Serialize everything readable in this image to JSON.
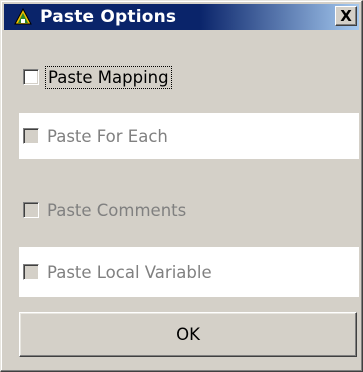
{
  "dialog": {
    "title": "Paste Options",
    "title_icon": "paste-app-icon",
    "close_label": "X",
    "close_icon": "close-icon"
  },
  "options": [
    {
      "label": "Paste Mapping",
      "checked": false,
      "enabled": true
    },
    {
      "label": "Paste For Each",
      "checked": false,
      "enabled": false
    },
    {
      "label": "Paste Comments",
      "checked": false,
      "enabled": false
    },
    {
      "label": "Paste Local Variable",
      "checked": false,
      "enabled": false
    }
  ],
  "buttons": {
    "ok_label": "OK"
  },
  "colors": {
    "titlebar": "#0a246a",
    "face": "#d4d0c8",
    "disabled_text": "#808080"
  }
}
